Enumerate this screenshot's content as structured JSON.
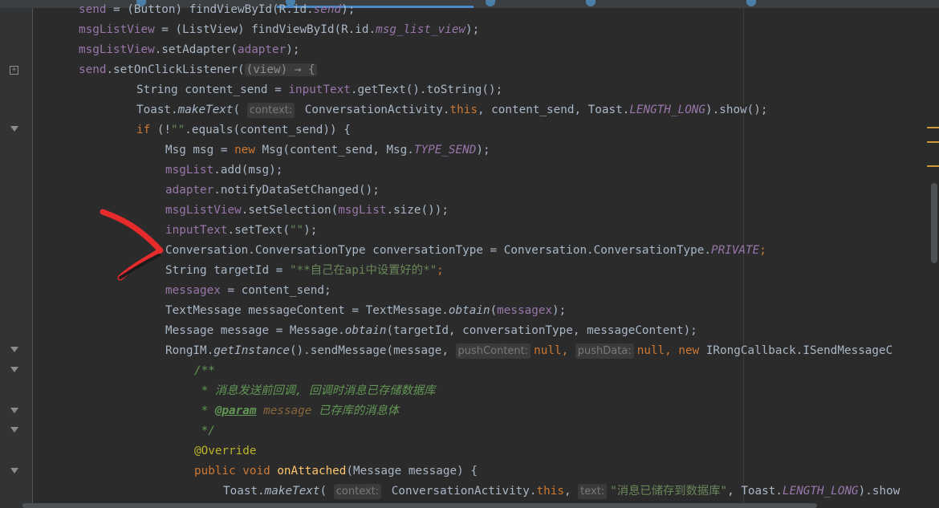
{
  "editor": {
    "language": "Java",
    "theme_colors": {
      "background": "#2b2b2b",
      "gutter": "#313335",
      "keyword": "#cc7832",
      "field": "#9876aa",
      "string": "#6a8759",
      "method_decl": "#ffc66d",
      "annotation": "#bbb529",
      "doc_comment": "#629755",
      "annotation_mark": "#e52b2b"
    },
    "annotation_mark": "red-arrow-pointing-at-conversation-type-line"
  },
  "code": {
    "l0": {
      "a": "send",
      "b": " = (Button) findViewById(R.id.",
      "c": "send",
      "d": ");"
    },
    "l1": {
      "a": "msgListView",
      "b": " = (ListView) findViewById(R.id.",
      "c": "msg_list_view",
      "d": ");"
    },
    "l2": {
      "a": "msgListView",
      "b": ".setAdapter(",
      "c": "adapter",
      "d": ");"
    },
    "l3": {
      "a": "send",
      "b": ".setOnClickListener(",
      "c": "(view) → {"
    },
    "l4": {
      "a": "String content_send = ",
      "b": "inputText",
      "c": ".getText().toString();"
    },
    "l5": {
      "a": "Toast.",
      "b": "makeText",
      "c": "( ",
      "hint": "context:",
      "d": " ConversationActivity.",
      "e": "this",
      "f": ", content_send, Toast.",
      "g": "LENGTH_LONG",
      "h": ").show();"
    },
    "l6": {
      "a": "if",
      "b": " (!",
      "c": "\"\"",
      "d": ".equals(content_send)) {"
    },
    "l7": {
      "a": "Msg msg = ",
      "b": "new",
      "c": " Msg(content_send, Msg.",
      "d": "TYPE_SEND",
      "e": ");"
    },
    "l8": {
      "a": "msgList",
      "b": ".add(msg);"
    },
    "l9": {
      "a": "adapter",
      "b": ".notifyDataSetChanged();"
    },
    "l10": {
      "a": "msgListView",
      "b": ".setSelection(",
      "c": "msgList",
      "d": ".size());"
    },
    "l11": {
      "a": "inputText",
      "b": ".setText(",
      "c": "\"\"",
      "d": ");"
    },
    "l12": {
      "a": "Conversation.ConversationType conversationType = Conversation.ConversationType.",
      "b": "PRIVATE",
      "c": ";"
    },
    "l13": {
      "a": "String targetId = ",
      "b": "\"**自己在api中设置好的*\"",
      "c": ";"
    },
    "l14": {
      "a": "messagex",
      "b": " = content_send;"
    },
    "l15": {
      "a": "TextMessage messageContent = TextMessage.",
      "b": "obtain",
      "c": "(",
      "d": "messagex",
      "e": ");"
    },
    "l16": {
      "a": "Message message = Message.",
      "b": "obtain",
      "c": "(targetId, conversationType, messageContent);"
    },
    "l17": {
      "a": "RongIM.",
      "b": "getInstance",
      "c": "().sendMessage(message, ",
      "hint1": "pushContent:",
      "d": "null",
      "e": ", ",
      "hint2": "pushData:",
      "f": "null",
      "g": ", ",
      "h": "new",
      "i": " IRongCallback.ISendMessageC"
    },
    "l18": {
      "a": "/**"
    },
    "l19": {
      "a": " * 消息发送前回调, 回调时消息已存储数据库"
    },
    "l20": {
      "a": " * ",
      "b": "@param",
      "c": " message",
      "d": " 已存库的消息体"
    },
    "l21": {
      "a": " */"
    },
    "l22": {
      "a": "@Override"
    },
    "l23": {
      "a": "public",
      "b": " ",
      "c": "void",
      "d": " ",
      "e": "onAttached",
      "f": "(Message message) {"
    },
    "l24": {
      "a": "Toast.",
      "b": "makeText",
      "c": "( ",
      "hint1": "context:",
      "d": " ConversationActivity.",
      "e": "this",
      "f": ", ",
      "hint2": "text:",
      "g": "\"消息已储存到数据库\"",
      "h": ", Toast.",
      "i": "LENGTH_LONG",
      "j": ").show"
    }
  }
}
